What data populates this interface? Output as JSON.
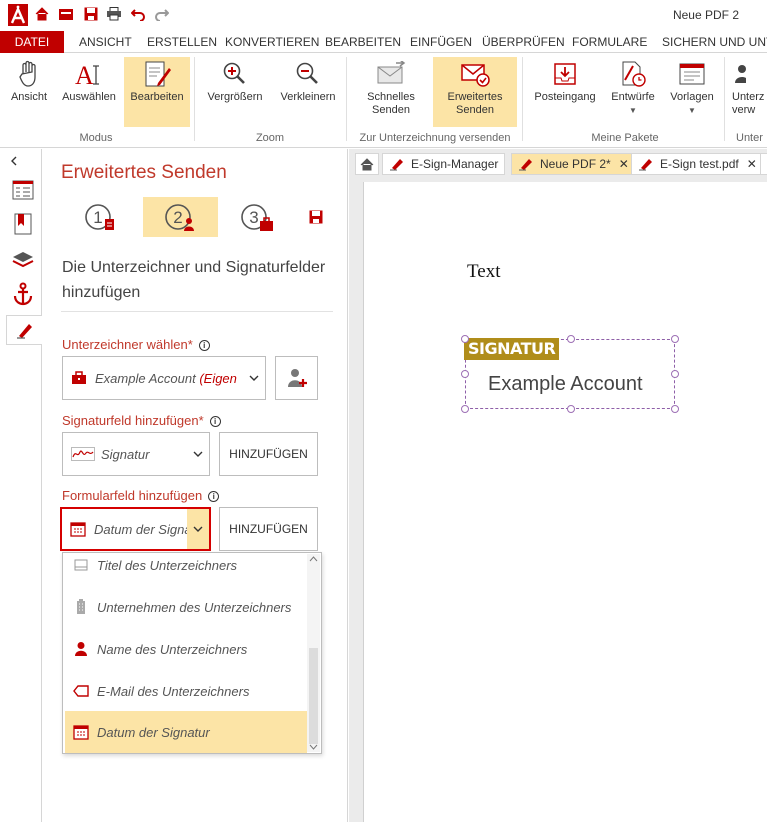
{
  "window": {
    "doc_title": "Neue PDF 2"
  },
  "menu": {
    "file": "DATEI",
    "tabs": [
      "ANSICHT",
      "ERSTELLEN",
      "KONVERTIEREN",
      "BEARBEITEN",
      "EINFÜGEN",
      "ÜBERPRÜFEN",
      "FORMULARE",
      "SICHERN UND UNT"
    ]
  },
  "ribbon": {
    "modus": {
      "label": "Modus",
      "items": [
        "Ansicht",
        "Auswählen",
        "Bearbeiten"
      ]
    },
    "zoom": {
      "label": "Zoom",
      "items": [
        "Vergrößern",
        "Verkleinern"
      ]
    },
    "send": {
      "label": "Zur Unterzeichnung versenden",
      "items": [
        [
          "Schnelles",
          "Senden"
        ],
        [
          "Erweitertes",
          "Senden"
        ]
      ]
    },
    "packages": {
      "label": "Meine Pakete",
      "items": [
        "Posteingang",
        "Entwürfe",
        "Vorlagen"
      ]
    },
    "cut": {
      "label": "Unter",
      "item": [
        "Unterz",
        "verw"
      ]
    }
  },
  "panel": {
    "title": "Erweitertes Senden",
    "steps": [
      "1",
      "2",
      "3"
    ],
    "description": "Die Unterzeichner und Signaturfelder hinzufügen",
    "signer": {
      "label": "Unterzeichner wählen",
      "required": "*",
      "value": "Example Account",
      "value_suffix": "(Eigen"
    },
    "signature_field": {
      "label": "Signaturfeld hinzufügen",
      "required": "*",
      "value": "Signatur",
      "button": "HINZUFÜGEN"
    },
    "form_field": {
      "label": "Formularfeld hinzufügen",
      "value": "Datum der Signatur",
      "button": "HINZUFÜGEN"
    },
    "dropdown_options": [
      "Titel des Unterzeichners",
      "Unternehmen des Unterzeichners",
      "Name des Unterzeichners",
      "E-Mail des Unterzeichners",
      "Datum der Signatur"
    ]
  },
  "doc_tabs": [
    "E-Sign-Manager",
    "Neue PDF 2*",
    "E-Sign test.pdf"
  ],
  "document": {
    "text": "Text",
    "signature_badge": "SIGNATUR",
    "signature_name": "Example Account"
  },
  "colors": {
    "accent": "#c00000",
    "highlight": "#fce4a6",
    "label_red": "#c0392b",
    "badge": "#b08d1a"
  }
}
